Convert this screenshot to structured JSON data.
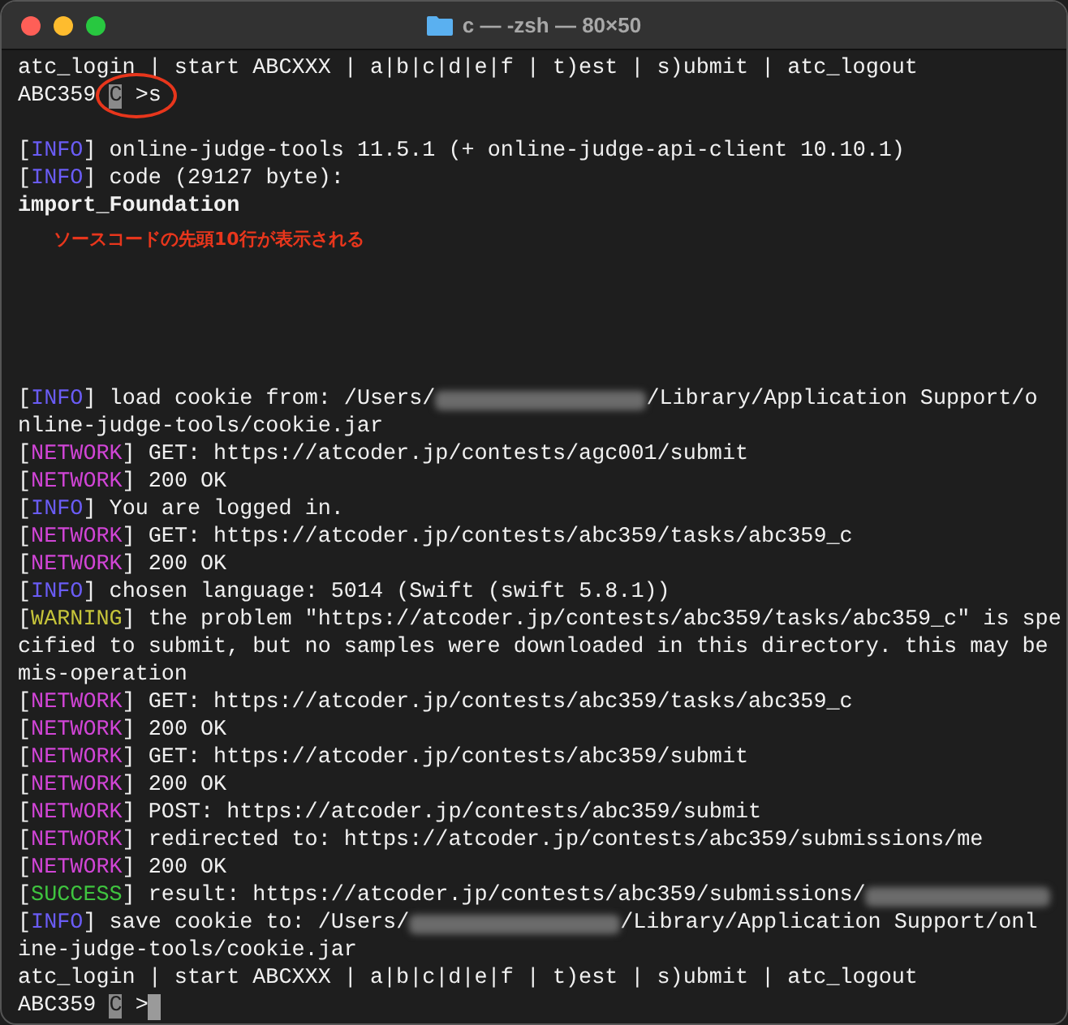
{
  "window": {
    "title": "c — -zsh — 80×50"
  },
  "lines": [
    {
      "kind": "text",
      "text": "atc_login | start ABCXXX | a|b|c|d|e|f | t)est | s)ubmit | atc_logout"
    },
    {
      "kind": "prompt",
      "prefix": "ABC359",
      "highlight": "C",
      "suffix": ">s",
      "circled": true,
      "cursor": false
    },
    {
      "kind": "blank"
    },
    {
      "kind": "log",
      "tag": "[INFO]",
      "color": "#6a5cf5",
      "parts": [
        {
          "kind": "text",
          "text": "online-judge-tools 11.5.1 (+ online-judge-api-client 10.10.1)"
        }
      ]
    },
    {
      "kind": "log",
      "tag": "[INFO]",
      "color": "#6a5cf5",
      "parts": [
        {
          "kind": "text",
          "text": "code (29127 byte):"
        }
      ]
    },
    {
      "kind": "bold",
      "text": "import_Foundation"
    },
    {
      "kind": "annotation",
      "text": "ソースコードの先頭10行が表示される"
    },
    {
      "kind": "blank"
    },
    {
      "kind": "blank"
    },
    {
      "kind": "blank"
    },
    {
      "kind": "blank"
    },
    {
      "kind": "blank"
    },
    {
      "kind": "log",
      "tag": "[INFO]",
      "color": "#6a5cf5",
      "parts": [
        {
          "kind": "text",
          "text": "load cookie from: /Users/"
        },
        {
          "kind": "redacted"
        },
        {
          "kind": "text",
          "text": "/Library/Application Support/o"
        }
      ]
    },
    {
      "kind": "text",
      "text": "nline-judge-tools/cookie.jar"
    },
    {
      "kind": "log",
      "tag": "[NETWORK]",
      "color": "#d145d6",
      "parts": [
        {
          "kind": "text",
          "text": "GET: https://atcoder.jp/contests/agc001/submit"
        }
      ]
    },
    {
      "kind": "log",
      "tag": "[NETWORK]",
      "color": "#d145d6",
      "parts": [
        {
          "kind": "text",
          "text": "200 OK"
        }
      ]
    },
    {
      "kind": "log",
      "tag": "[INFO]",
      "color": "#6a5cf5",
      "parts": [
        {
          "kind": "text",
          "text": "You are logged in."
        }
      ]
    },
    {
      "kind": "log",
      "tag": "[NETWORK]",
      "color": "#d145d6",
      "parts": [
        {
          "kind": "text",
          "text": "GET: https://atcoder.jp/contests/abc359/tasks/abc359_c"
        }
      ]
    },
    {
      "kind": "log",
      "tag": "[NETWORK]",
      "color": "#d145d6",
      "parts": [
        {
          "kind": "text",
          "text": "200 OK"
        }
      ]
    },
    {
      "kind": "log",
      "tag": "[INFO]",
      "color": "#6a5cf5",
      "parts": [
        {
          "kind": "text",
          "text": "chosen language: 5014 (Swift (swift 5.8.1))"
        }
      ]
    },
    {
      "kind": "log",
      "tag": "[WARNING]",
      "color": "#c6c43a",
      "parts": [
        {
          "kind": "text",
          "text": "the problem \"https://atcoder.jp/contests/abc359/tasks/abc359_c\" is spe"
        }
      ]
    },
    {
      "kind": "text",
      "text": "cified to submit, but no samples were downloaded in this directory. this may be"
    },
    {
      "kind": "text",
      "text": "mis-operation"
    },
    {
      "kind": "log",
      "tag": "[NETWORK]",
      "color": "#d145d6",
      "parts": [
        {
          "kind": "text",
          "text": "GET: https://atcoder.jp/contests/abc359/tasks/abc359_c"
        }
      ]
    },
    {
      "kind": "log",
      "tag": "[NETWORK]",
      "color": "#d145d6",
      "parts": [
        {
          "kind": "text",
          "text": "200 OK"
        }
      ]
    },
    {
      "kind": "log",
      "tag": "[NETWORK]",
      "color": "#d145d6",
      "parts": [
        {
          "kind": "text",
          "text": "GET: https://atcoder.jp/contests/abc359/submit"
        }
      ]
    },
    {
      "kind": "log",
      "tag": "[NETWORK]",
      "color": "#d145d6",
      "parts": [
        {
          "kind": "text",
          "text": "200 OK"
        }
      ]
    },
    {
      "kind": "log",
      "tag": "[NETWORK]",
      "color": "#d145d6",
      "parts": [
        {
          "kind": "text",
          "text": "POST: https://atcoder.jp/contests/abc359/submit"
        }
      ]
    },
    {
      "kind": "log",
      "tag": "[NETWORK]",
      "color": "#d145d6",
      "parts": [
        {
          "kind": "text",
          "text": "redirected to: https://atcoder.jp/contests/abc359/submissions/me"
        }
      ]
    },
    {
      "kind": "log",
      "tag": "[NETWORK]",
      "color": "#d145d6",
      "parts": [
        {
          "kind": "text",
          "text": "200 OK"
        }
      ]
    },
    {
      "kind": "log",
      "tag": "[SUCCESS]",
      "color": "#3fc43f",
      "parts": [
        {
          "kind": "text",
          "text": "result: https://atcoder.jp/contests/abc359/submissions/"
        },
        {
          "kind": "redacted"
        }
      ]
    },
    {
      "kind": "log",
      "tag": "[INFO]",
      "color": "#6a5cf5",
      "parts": [
        {
          "kind": "text",
          "text": "save cookie to: /Users/"
        },
        {
          "kind": "redacted"
        },
        {
          "kind": "text",
          "text": "/Library/Application Support/onl"
        }
      ]
    },
    {
      "kind": "text",
      "text": "ine-judge-tools/cookie.jar"
    },
    {
      "kind": "text",
      "text": "atc_login | start ABCXXX | a|b|c|d|e|f | t)est | s)ubmit | atc_logout"
    },
    {
      "kind": "prompt",
      "prefix": "ABC359",
      "highlight": "C",
      "suffix": ">",
      "circled": false,
      "cursor": true
    }
  ]
}
